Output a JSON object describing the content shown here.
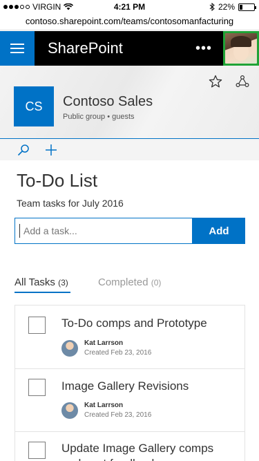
{
  "status_bar": {
    "carrier": "VIRGIN",
    "time": "4:21 PM",
    "battery": "22%",
    "battery_level": 0.22
  },
  "browser": {
    "url": "contoso.sharepoint.com/teams/contosomanfacturing"
  },
  "app_header": {
    "title": "SharePoint",
    "more": "•••"
  },
  "site": {
    "logo_initials": "CS",
    "title": "Contoso Sales",
    "subtitle": "Public group • guests"
  },
  "page": {
    "title": "To-Do List",
    "subtitle": "Team tasks for July 2016"
  },
  "task_input": {
    "placeholder": "Add a task...",
    "value": ""
  },
  "add_button_label": "Add",
  "tabs": {
    "all_label": "All Tasks",
    "all_count": "(3)",
    "completed_label": "Completed",
    "completed_count": "(0)"
  },
  "tasks": [
    {
      "title": "To-Do comps and Prototype",
      "author": "Kat Larrson",
      "created": "Created Feb 23, 2016"
    },
    {
      "title": "Image Gallery Revisions",
      "author": "Kat Larrson",
      "created": "Created Feb 23, 2016"
    },
    {
      "title": "Update Image Gallery comps and post feedback",
      "author": "",
      "created": ""
    }
  ],
  "colors": {
    "accent": "#0072c6",
    "header_bg": "#000000",
    "presence": "#1fa336"
  },
  "icons": [
    "wifi-icon",
    "bluetooth-icon",
    "battery-icon",
    "menu-icon",
    "more-icon",
    "star-icon",
    "share-icon",
    "search-icon",
    "plus-icon"
  ]
}
